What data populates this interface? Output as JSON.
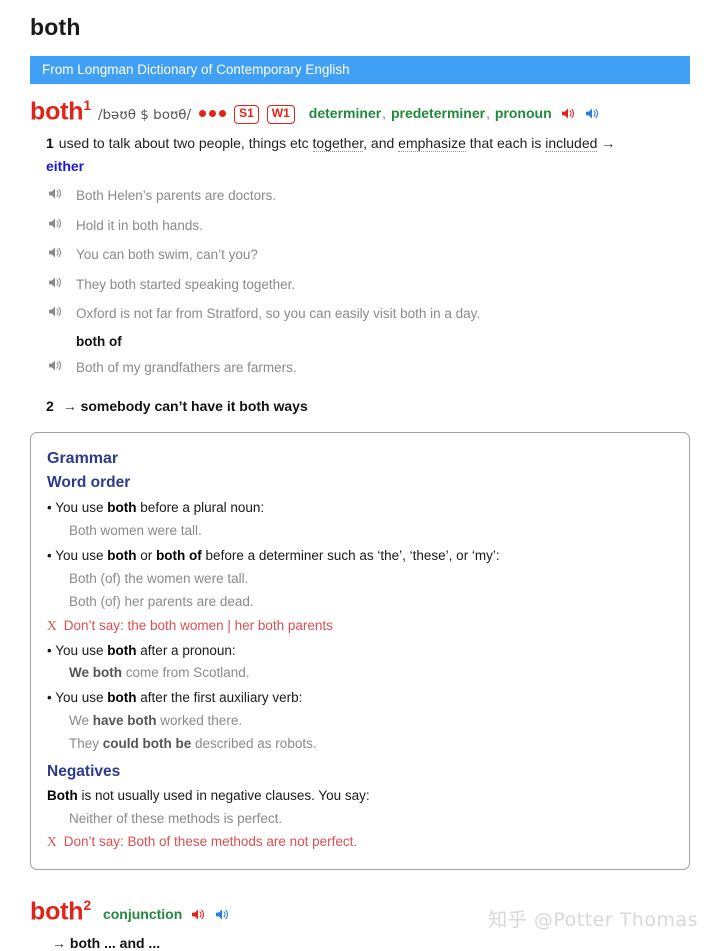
{
  "page": {
    "title": "both",
    "watermark": "知乎 @Potter Thomas"
  },
  "source_banner": {
    "label": "From Longman Dictionary of Contemporary English"
  },
  "entry1": {
    "headword": "both",
    "homograph": "1",
    "pronunciation": "/bəʊθ $ boʊθ/",
    "frequency_dots": 3,
    "badges": [
      "S1",
      "W1"
    ],
    "parts_of_speech": [
      "determiner",
      "predeterminer",
      "pronoun"
    ],
    "pos_separator": ",",
    "audio_uk_label": "speaker-british",
    "audio_us_label": "speaker-american",
    "senses": [
      {
        "number": "1",
        "definition_pre": "used to talk about two people, things etc ",
        "definition_link1": "together",
        "definition_mid": ", and ",
        "definition_link2": "emphasize",
        "definition_mid2": " that each is ",
        "definition_link3": "included",
        "arrow": "→",
        "cross_reference": "either",
        "examples": [
          "Both Helen’s parents are doctors.",
          "Hold it in both hands.",
          "You can both swim, can’t you?",
          "They both started speaking together.",
          "Oxford is not far from Stratford, so you can easily visit both in a day."
        ],
        "collocation": "both of",
        "collocation_examples": [
          "Both of my grandfathers are farmers."
        ]
      },
      {
        "number": "2",
        "arrow": "→",
        "phrase": "somebody can’t have it both ways"
      }
    ]
  },
  "grammar_box": {
    "title": "Grammar",
    "sections": [
      {
        "heading": "Word order",
        "items": [
          {
            "type": "bullet",
            "pre": "• You use ",
            "bold1": "both",
            "post": " before a plural noun:"
          },
          {
            "type": "example",
            "text": "Both women were tall."
          },
          {
            "type": "bullet",
            "pre": "• You use ",
            "bold1": "both",
            "mid": " or ",
            "bold2": "both of",
            "post": " before a determiner such as ‘the’, ‘these’, or ‘my’:"
          },
          {
            "type": "example",
            "text": "Both (of) the women were tall."
          },
          {
            "type": "example",
            "text": "Both (of) her parents are dead."
          },
          {
            "type": "wrong",
            "mark": "X",
            "text": "Don’t say: the both women | her both parents"
          },
          {
            "type": "bullet",
            "pre": "• You use ",
            "bold1": "both",
            "post": " after a pronoun:"
          },
          {
            "type": "example",
            "bold_prefix": "We both",
            "text": " come from Scotland."
          },
          {
            "type": "bullet",
            "pre": "• You use ",
            "bold1": "both",
            "post": " after the first auxiliary verb:"
          },
          {
            "type": "example",
            "plain_prefix": "We ",
            "bold_prefix": "have both",
            "text": " worked there."
          },
          {
            "type": "example",
            "plain_prefix": "They ",
            "bold_prefix": "could both be",
            "text": " described as robots."
          }
        ]
      },
      {
        "heading": "Negatives",
        "items": [
          {
            "type": "plain",
            "bold1": "Both",
            "post": " is not usually used in negative clauses. You say:"
          },
          {
            "type": "example",
            "text": "Neither of these methods is perfect."
          },
          {
            "type": "wrong",
            "mark": "X",
            "text": "Don’t say: Both of these methods are not perfect."
          }
        ]
      }
    ]
  },
  "entry2": {
    "headword": "both",
    "homograph": "2",
    "parts_of_speech": [
      "conjunction"
    ],
    "audio_uk_label": "speaker-british",
    "audio_us_label": "speaker-american",
    "sense": {
      "arrow": "→",
      "phrase": "both ... and ..."
    }
  },
  "colors": {
    "headword_red": "#e2231a",
    "banner_blue": "#3fa0f5",
    "pos_green": "#1f8a3b",
    "xref_blue": "#1a1ad6",
    "grammar_navy": "#2e3a8c",
    "wrong_red": "#d94f4f",
    "example_gray": "#8a8a8a"
  }
}
